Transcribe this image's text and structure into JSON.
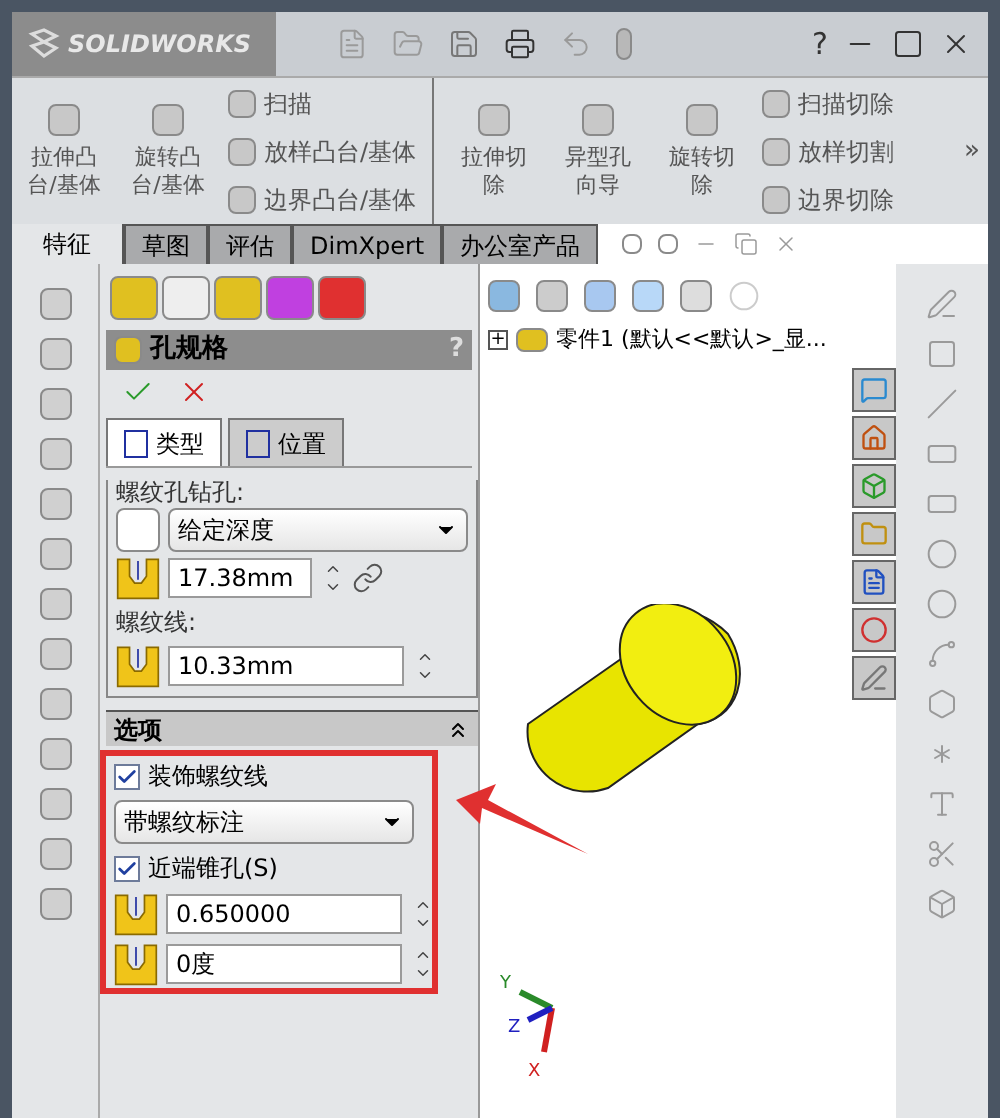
{
  "title_bar": {
    "logo": "SOLIDWORKS",
    "help": "?"
  },
  "ribbon": {
    "groups": [
      {
        "large": [
          {
            "label": "拉伸凸台/基体"
          },
          {
            "label": "旋转凸台/基体"
          }
        ],
        "small": [
          {
            "label": "扫描"
          },
          {
            "label": "放样凸台/基体"
          },
          {
            "label": "边界凸台/基体"
          }
        ]
      },
      {
        "large": [
          {
            "label": "拉伸切除"
          },
          {
            "label": "异型孔向导"
          },
          {
            "label": "旋转切除"
          }
        ],
        "small": [
          {
            "label": "扫描切除"
          },
          {
            "label": "放样切割"
          },
          {
            "label": "边界切除"
          }
        ]
      }
    ],
    "more": "»"
  },
  "tabs": [
    {
      "label": "特征",
      "selected": true
    },
    {
      "label": "草图",
      "selected": false
    },
    {
      "label": "评估",
      "selected": false
    },
    {
      "label": "DimXpert",
      "selected": false
    },
    {
      "label": "办公室产品",
      "selected": false
    }
  ],
  "property_manager": {
    "title": "孔规格",
    "help": "?",
    "subtabs": [
      {
        "label": "类型",
        "selected": true
      },
      {
        "label": "位置",
        "selected": false
      }
    ],
    "end_condition": {
      "label": "螺纹孔钻孔:",
      "value": "给定深度",
      "depth": "17.38mm"
    },
    "thread": {
      "label": "螺纹线:",
      "value": "10.33mm"
    },
    "options": {
      "title": "选项",
      "cosmetic_thread": {
        "label": "装饰螺纹线",
        "checked": true
      },
      "thread_callout": "带螺纹标注",
      "near_countersink": {
        "label": "近端锥孔(S)",
        "checked": true
      },
      "diameter": "0.650000",
      "angle": "0度"
    }
  },
  "tree": {
    "expander": "+",
    "label": "零件1  (默认<<默认>_显..."
  },
  "triad": {
    "y": "Y",
    "z": "Z",
    "x": "X"
  }
}
